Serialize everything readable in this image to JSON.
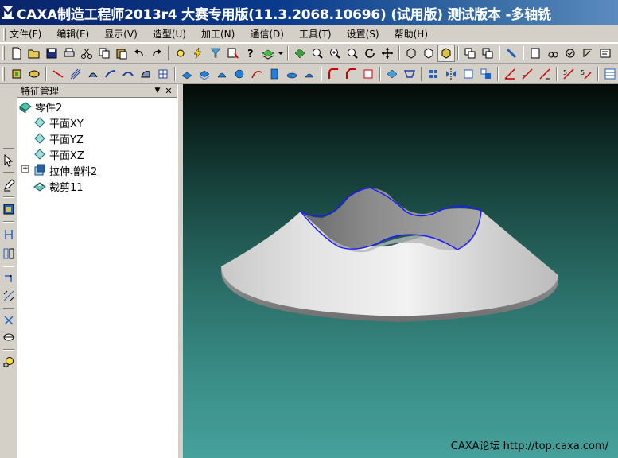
{
  "window": {
    "title": "CAXA制造工程师2013r4 大赛专用版(11.3.2068.10696) (试用版) 测试版本 -多轴铣"
  },
  "menu": {
    "items": [
      {
        "label": "文件(F)"
      },
      {
        "label": "编辑(E)"
      },
      {
        "label": "显示(V)"
      },
      {
        "label": "造型(U)"
      },
      {
        "label": "加工(N)"
      },
      {
        "label": "通信(D)"
      },
      {
        "label": "工具(T)"
      },
      {
        "label": "设置(S)"
      },
      {
        "label": "帮助(H)"
      }
    ]
  },
  "panel": {
    "title": "特征管理",
    "pin_glyph": "▼",
    "close_glyph": "✕",
    "tree": [
      {
        "label": "零件2",
        "icon": "part-icon"
      },
      {
        "label": "平面XY",
        "icon": "plane-icon"
      },
      {
        "label": "平面YZ",
        "icon": "plane-icon"
      },
      {
        "label": "平面XZ",
        "icon": "plane-icon"
      },
      {
        "label": "拉伸增料2",
        "icon": "extrude-icon",
        "expander": "+"
      },
      {
        "label": "裁剪11",
        "icon": "trim-icon"
      }
    ]
  },
  "viewport": {
    "watermark": "CAXA论坛 http://top.caxa.com/"
  },
  "colors": {
    "title_bar": "#0a246a",
    "window_face": "#d4d0c8",
    "viewport_top": "#030906",
    "viewport_bottom": "#46a09b",
    "edge_highlight": "#1a1aff"
  }
}
